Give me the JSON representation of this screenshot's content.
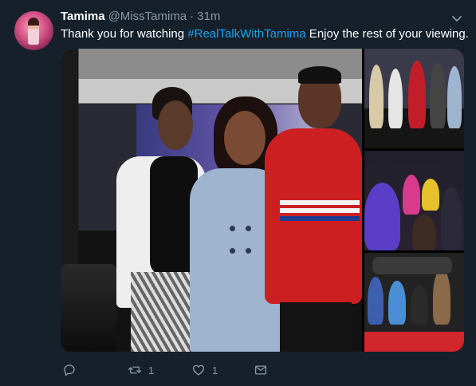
{
  "tweet": {
    "display_name": "Tamima",
    "handle": "@MissTamima",
    "separator": "·",
    "timestamp": "31m",
    "text_before": "Thank you for watching ",
    "hashtag": "#RealTalkWithTamima",
    "text_after": " Enjoy the rest of your viewing.",
    "media_count": 4
  },
  "actions": {
    "reply_count": "",
    "retweet_count": "1",
    "like_count": "1"
  },
  "colors": {
    "background": "#15202b",
    "secondary_text": "#8899a6",
    "link": "#1da1f2"
  },
  "icons": [
    "avatar",
    "chevron-down-icon",
    "reply-icon",
    "retweet-icon",
    "like-icon",
    "share-icon"
  ]
}
